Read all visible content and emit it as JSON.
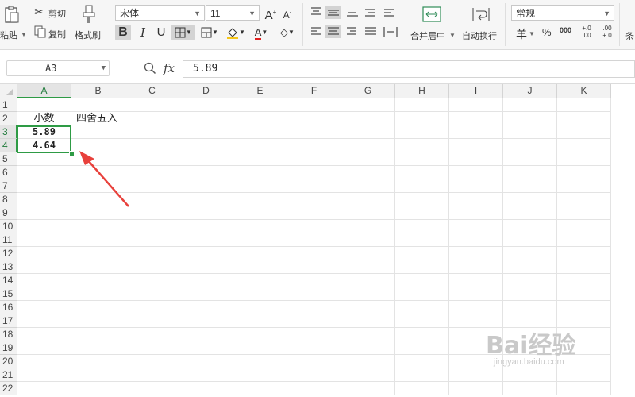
{
  "ribbon": {
    "clipboard": {
      "paste": "粘贴",
      "cut": "剪切",
      "copy": "复制",
      "format_painter": "格式刷"
    },
    "font": {
      "family": "宋体",
      "size": "11"
    },
    "alignment": {
      "merge_center": "合并居中",
      "wrap_text": "自动换行"
    },
    "number": {
      "format": "常规",
      "currency_symbol": "羊",
      "percent": "%",
      "thousands": "000",
      "inc_decimal": "+.0 .00",
      "dec_decimal": ".00 +.0"
    },
    "overflow_label": "条"
  },
  "formula_bar": {
    "name_box": "A3",
    "fx_label": "fx",
    "content": "5.89"
  },
  "sheet": {
    "columns": [
      "A",
      "B",
      "C",
      "D",
      "E",
      "F",
      "G",
      "H",
      "I",
      "J",
      "K"
    ],
    "rows": [
      "1",
      "2",
      "3",
      "4",
      "5",
      "6",
      "7",
      "8",
      "9",
      "10",
      "11",
      "12",
      "13",
      "14",
      "15",
      "16",
      "17",
      "18",
      "19",
      "20",
      "21",
      "22"
    ],
    "cells": {
      "A2": "小数",
      "B2": "四舍五入",
      "A3": "5.89",
      "A4": "4.64"
    },
    "selected_range": "A3:A4"
  },
  "annotation": {
    "arrow_color": "#e8413c"
  },
  "watermark": {
    "brand": "Bai经验",
    "url": "jingyan.baidu.com"
  }
}
